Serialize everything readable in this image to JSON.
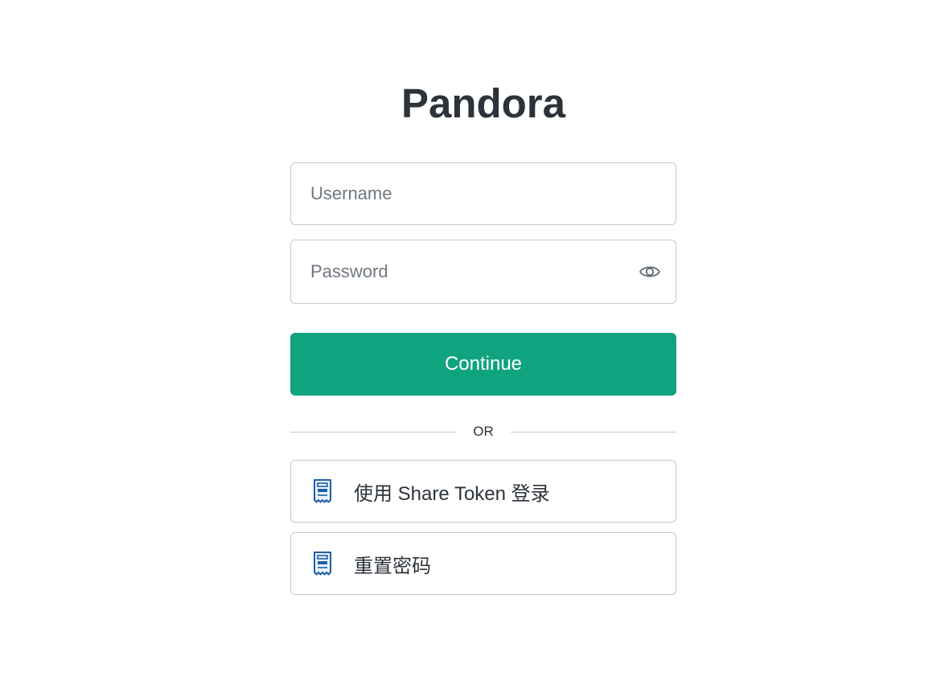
{
  "app": {
    "title": "Pandora"
  },
  "login_form": {
    "username": {
      "placeholder": "Username",
      "value": ""
    },
    "password": {
      "placeholder": "Password",
      "value": "",
      "toggle_icon": "eye-icon"
    },
    "continue_label": "Continue",
    "divider_text": "OR"
  },
  "alternatives": [
    {
      "label": "使用 Share Token 登录",
      "icon": "receipt-icon"
    },
    {
      "label": "重置密码",
      "icon": "receipt-icon"
    }
  ],
  "colors": {
    "accent": "#10a37f",
    "text": "#2d333a",
    "border": "#c2c8d0",
    "icon_blue": "#1f5fa8"
  }
}
